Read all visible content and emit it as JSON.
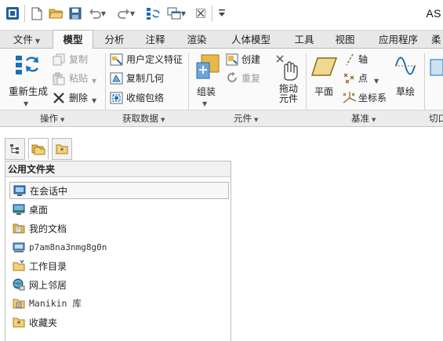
{
  "app": {
    "title_prefix": "AS"
  },
  "tabs": [
    {
      "label": "文件",
      "has_dropdown": true
    },
    {
      "label": "模型",
      "active": true
    },
    {
      "label": "分析"
    },
    {
      "label": "注释"
    },
    {
      "label": "渲染"
    },
    {
      "label": "人体模型"
    },
    {
      "label": "工具"
    },
    {
      "label": "视图"
    },
    {
      "label": "应用程序"
    },
    {
      "label": "柔"
    }
  ],
  "ribbon": {
    "operations": {
      "regenerate": "重新生成",
      "copy": "复制",
      "paste": "粘贴",
      "delete": "删除",
      "group_label": "操作"
    },
    "get_data": {
      "udf": "用户定义特征",
      "copy_geometry": "复制几何",
      "shrinkwrap": "收缩包络",
      "group_label": "获取数据"
    },
    "component": {
      "assemble": "组装",
      "create": "创建",
      "repeat": "重复",
      "drag": "拖动元件",
      "group_label": "元件"
    },
    "datum": {
      "plane": "平面",
      "axis": "轴",
      "point": "点",
      "csys": "坐标系",
      "sketch": "草绘",
      "group_label": "基准"
    },
    "cut": {
      "group_label": "切口"
    }
  },
  "navigator": {
    "header": "公用文件夹",
    "items": [
      {
        "label": "在会话中",
        "icon": "monitor-icon",
        "selected": true
      },
      {
        "label": "桌面",
        "icon": "desktop-icon"
      },
      {
        "label": "我的文档",
        "icon": "documents-icon"
      },
      {
        "label": "p7am8na3nmg8g0n",
        "icon": "computer-icon",
        "mono": true
      },
      {
        "label": "工作目录",
        "icon": "work-folder-icon"
      },
      {
        "label": "网上邻居",
        "icon": "network-icon"
      },
      {
        "label": "Manikin 库",
        "icon": "library-icon"
      },
      {
        "label": "收藏夹",
        "icon": "favorites-icon"
      }
    ]
  },
  "colors": {
    "accent_blue": "#1a6fb8",
    "folder_yellow": "#e8b84a",
    "tab_bar": "#e8e8e8"
  }
}
